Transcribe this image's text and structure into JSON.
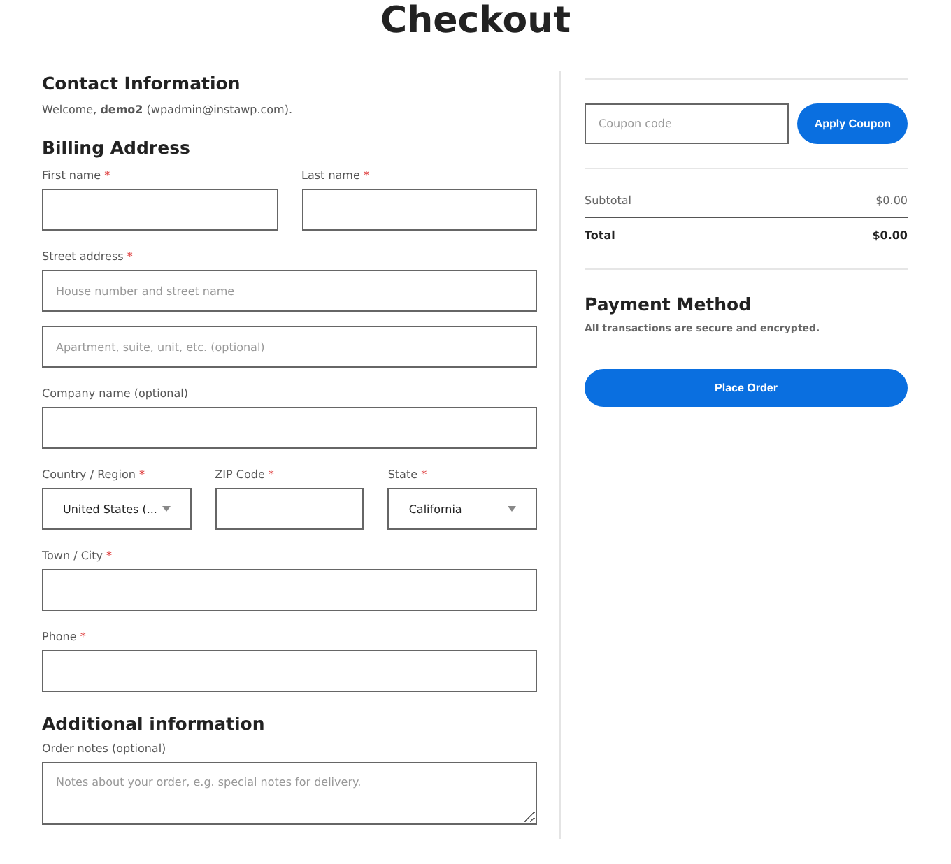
{
  "title": "Checkout",
  "contact": {
    "heading": "Contact Information",
    "welcome": "Welcome, **demo2** (wpadmin@instawp.com)."
  },
  "billing": {
    "heading": "Billing Address",
    "rows": [
      [
        {
          "label": "First name",
          "required_mark": "*",
          "kind": "text"
        },
        {
          "label": "Last name",
          "required_mark": "*",
          "kind": "text"
        }
      ],
      [
        {
          "label": "Street address",
          "required_mark": "*",
          "kind": "text",
          "placeholder": "House number and street name"
        }
      ],
      [
        {
          "kind": "text",
          "placeholder": "Apartment, suite, unit, etc. (optional)"
        }
      ],
      [
        {
          "label": "Company name (optional)",
          "kind": "text"
        }
      ],
      [
        {
          "label": "Country / Region",
          "required_mark": "*",
          "kind": "select",
          "value": "United States (..."
        },
        {
          "label": "ZIP Code",
          "required_mark": "*",
          "kind": "text"
        },
        {
          "label": "State",
          "required_mark": "*",
          "kind": "select",
          "value": "California"
        }
      ],
      [
        {
          "label": "Town / City",
          "required_mark": "*",
          "kind": "text"
        }
      ],
      [
        {
          "label": "Phone",
          "required_mark": "*",
          "kind": "text"
        }
      ]
    ]
  },
  "additional": {
    "heading": "Additional information",
    "notes": {
      "label": "Order notes (optional)",
      "kind": "textarea",
      "placeholder": "Notes about your order, e.g. special notes for delivery."
    }
  },
  "summary": {
    "coupon": {
      "placeholder": "Coupon code",
      "button": "Apply Coupon"
    },
    "lines": [
      {
        "label": "Subtotal",
        "amount": "$0.00",
        "kind": "subtotal"
      },
      {
        "label": "Total",
        "amount": "$0.00",
        "kind": "total"
      }
    ]
  },
  "payment": {
    "heading": "Payment Method",
    "note": "All transactions are secure and encrypted.",
    "button": "Place Order"
  }
}
